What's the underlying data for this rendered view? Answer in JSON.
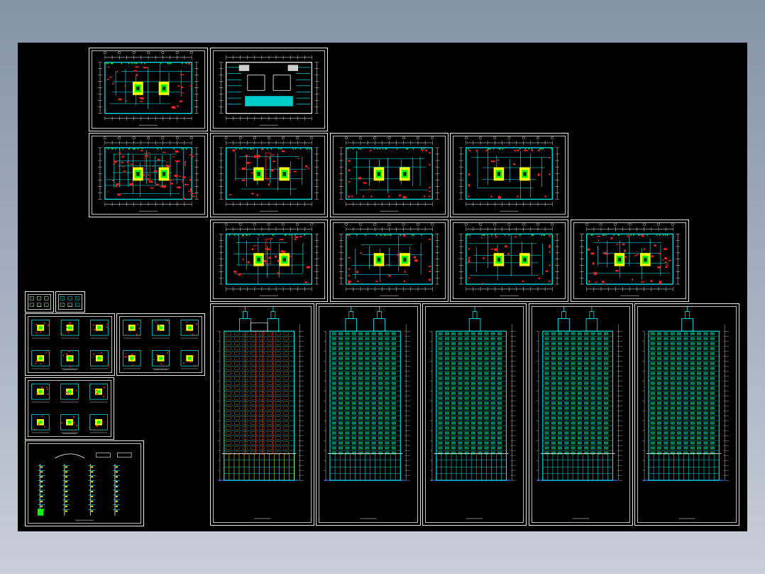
{
  "viewer": {
    "background_top": "#8593a8",
    "background_bottom": "#c9cfd9",
    "model_space_color": "#000000"
  },
  "colors": {
    "frame": "#e8e8e8",
    "wall": "#00ffff",
    "core": "#ffff00",
    "mark": "#ff2020",
    "green": "#00ff00",
    "white": "#ffffff",
    "blue": "#4060ff",
    "orange": "#ff9900"
  },
  "sheets": [
    {
      "id": "plan-01",
      "kind": "plan",
      "variant": "a",
      "title": ""
    },
    {
      "id": "plan-02",
      "kind": "plan",
      "variant": "roof",
      "title": ""
    },
    {
      "id": "plan-03",
      "kind": "plan",
      "variant": "dense",
      "title": ""
    },
    {
      "id": "plan-04",
      "kind": "plan",
      "variant": "b",
      "title": ""
    },
    {
      "id": "plan-05",
      "kind": "plan",
      "variant": "c",
      "title": ""
    },
    {
      "id": "plan-06",
      "kind": "plan",
      "variant": "c",
      "title": ""
    },
    {
      "id": "plan-07",
      "kind": "plan",
      "variant": "b",
      "title": ""
    },
    {
      "id": "plan-08",
      "kind": "plan",
      "variant": "c",
      "title": ""
    },
    {
      "id": "plan-09",
      "kind": "plan",
      "variant": "c",
      "title": ""
    },
    {
      "id": "plan-10",
      "kind": "plan",
      "variant": "d",
      "title": ""
    },
    {
      "id": "detail-sm-1",
      "kind": "details",
      "title": ""
    },
    {
      "id": "detail-sm-2",
      "kind": "details",
      "title": ""
    },
    {
      "id": "unit-plans-1",
      "kind": "units",
      "title": ""
    },
    {
      "id": "unit-plans-2",
      "kind": "units",
      "title": ""
    },
    {
      "id": "unit-plans-3",
      "kind": "units",
      "title": ""
    },
    {
      "id": "wall-sections",
      "kind": "sections",
      "title": ""
    },
    {
      "id": "section-a",
      "kind": "section",
      "title": ""
    },
    {
      "id": "elevation-1",
      "kind": "elevation",
      "twin": true,
      "title": ""
    },
    {
      "id": "elevation-2",
      "kind": "elevation",
      "twin": false,
      "title": ""
    },
    {
      "id": "elevation-3",
      "kind": "elevation",
      "twin": true,
      "title": ""
    },
    {
      "id": "elevation-4",
      "kind": "elevation",
      "twin": false,
      "title": ""
    }
  ]
}
